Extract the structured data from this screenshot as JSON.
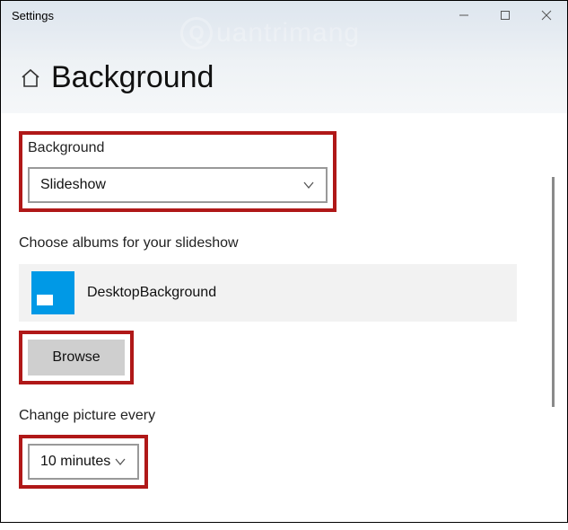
{
  "window": {
    "title": "Settings"
  },
  "page": {
    "heading": "Background"
  },
  "watermark": {
    "text": "uantrimang",
    "letter": "Q"
  },
  "background_section": {
    "label": "Background",
    "value": "Slideshow"
  },
  "albums": {
    "label": "Choose albums for your slideshow",
    "item_name": "DesktopBackground",
    "browse_label": "Browse"
  },
  "change_every": {
    "label": "Change picture every",
    "value": "10 minutes"
  }
}
